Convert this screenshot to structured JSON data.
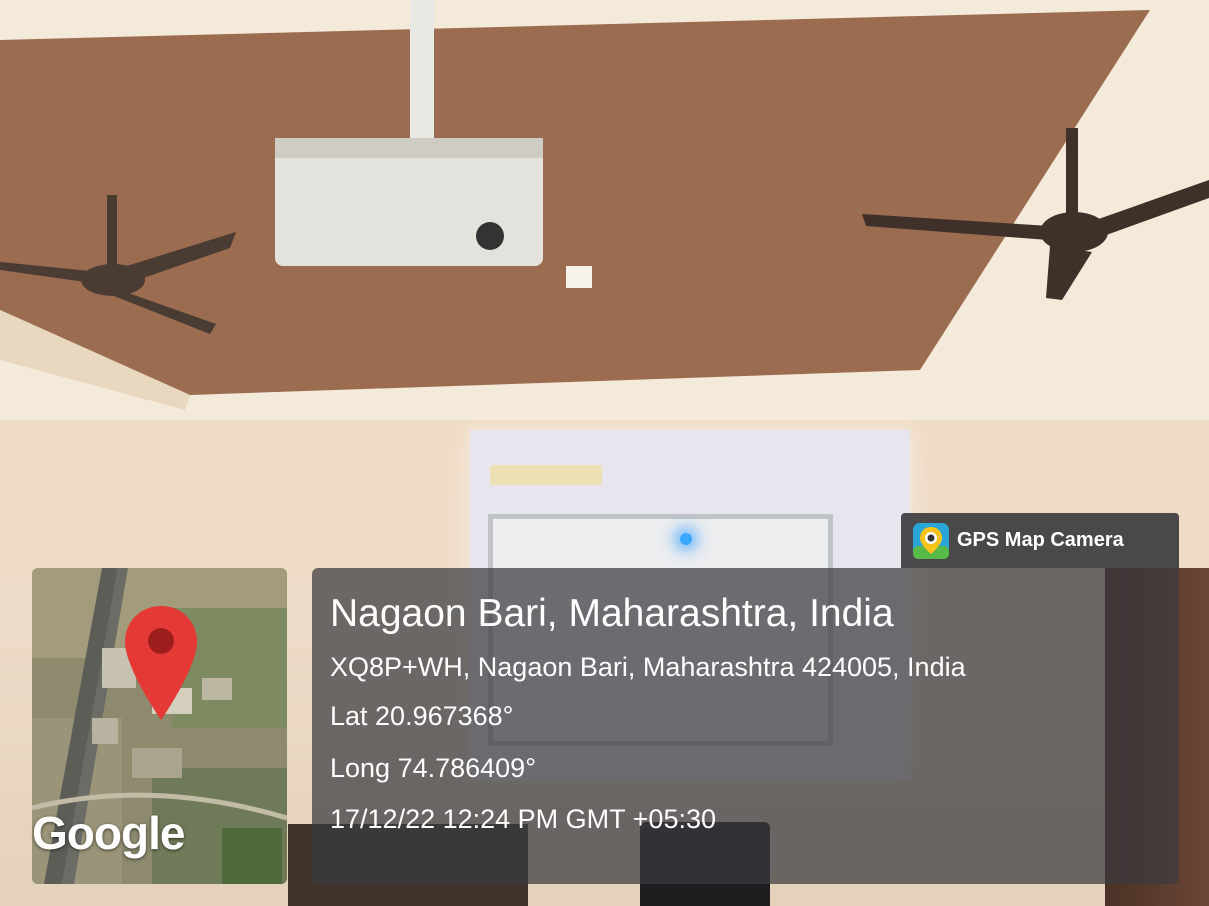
{
  "app_badge": {
    "name": "GPS Map Camera",
    "icon": "map-camera-icon"
  },
  "map": {
    "provider_logo": "Google",
    "pin_icon": "map-pin-icon",
    "pin_color": "#e53935"
  },
  "location": {
    "place": "Nagaon Bari, Maharashtra, India",
    "address": "XQ8P+WH, Nagaon Bari, Maharashtra 424005, India",
    "latitude": "Lat 20.967368°",
    "longitude": "Long 74.786409°",
    "timestamp": "17/12/22 12:24 PM GMT +05:30"
  },
  "colors": {
    "panel": "#3a3a3e",
    "ceiling": "#9a6a4e",
    "wall": "#efdcc4"
  }
}
